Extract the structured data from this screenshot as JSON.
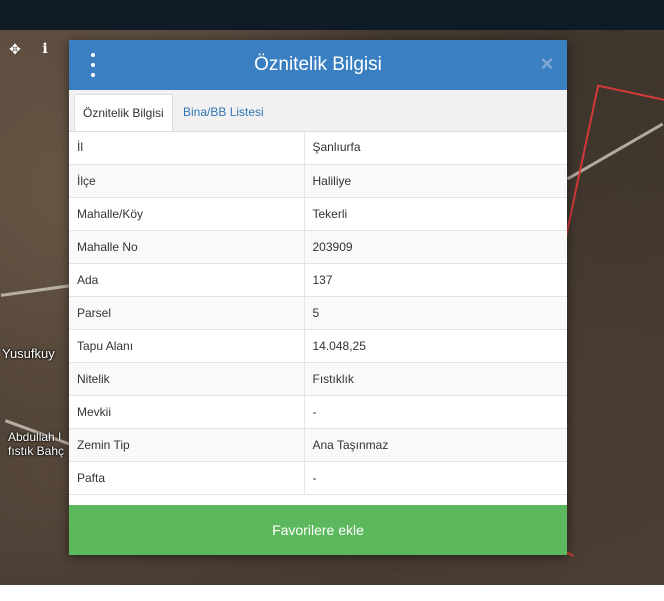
{
  "map": {
    "place_labels": [
      "Yusufkuy",
      "Abdullah I",
      "fıstık Bahç"
    ]
  },
  "modal": {
    "title": "Öznitelik Bilgisi",
    "close_symbol": "×",
    "tabs": [
      {
        "label": "Öznitelik Bilgisi",
        "active": true
      },
      {
        "label": "Bina/BB Listesi",
        "active": false
      }
    ],
    "attributes": [
      {
        "key": "İl",
        "value": "Şanlıurfa"
      },
      {
        "key": "İlçe",
        "value": "Haliliye"
      },
      {
        "key": "Mahalle/Köy",
        "value": "Tekerli"
      },
      {
        "key": "Mahalle No",
        "value": "203909"
      },
      {
        "key": "Ada",
        "value": "137"
      },
      {
        "key": "Parsel",
        "value": "5"
      },
      {
        "key": "Tapu Alanı",
        "value": "14.048,25"
      },
      {
        "key": "Nitelik",
        "value": "Fıstıklık"
      },
      {
        "key": "Mevkii",
        "value": "-"
      },
      {
        "key": "Zemin Tip",
        "value": "Ana Taşınmaz"
      },
      {
        "key": "Pafta",
        "value": "-"
      }
    ],
    "favorite_button": "Favorilere ekle"
  },
  "colors": {
    "header": "#3a7fc1",
    "favorite_button": "#5cb85c",
    "tab_link": "#2f75b5",
    "topbar": "#0f1b26"
  },
  "icons": {
    "menu": "kebab-menu-icon",
    "close": "close-icon",
    "map_pan": "move-icon",
    "map_info": "info-icon"
  }
}
